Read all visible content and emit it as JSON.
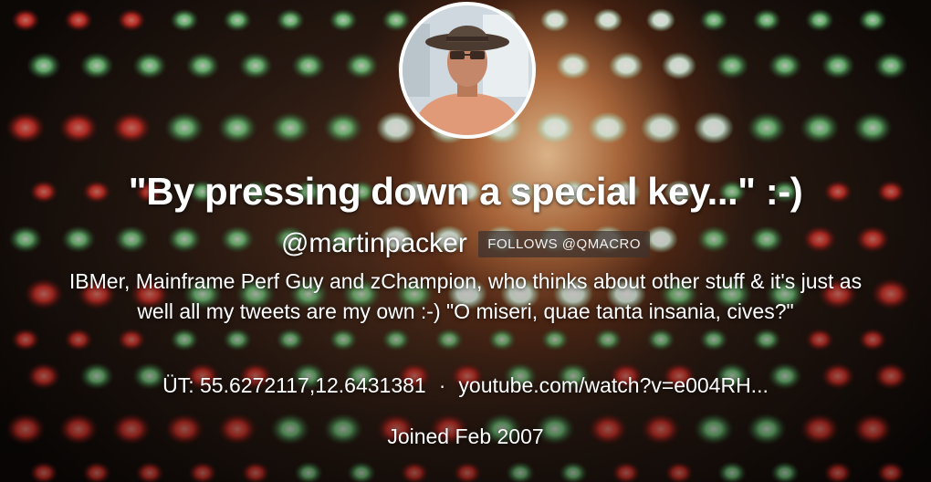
{
  "profile": {
    "display_name": "\"By pressing down a special key...\" :-)",
    "handle": "@martinpacker",
    "follows_badge": "FOLLOWS @QMACRO",
    "bio": "IBMer, Mainframe Perf Guy and zChampion, who thinks about other stuff & it's just as well all my tweets are my own :-) \"O miseri, quae tanta insania, cives?\"",
    "location": "ÜT: 55.6272117,12.6431381",
    "separator": "·",
    "website": "youtube.com/watch?v=e004RH...",
    "joined": "Joined Feb 2007"
  },
  "colors": {
    "led_green": "#7de08a",
    "led_red": "#e8332b",
    "text": "#ffffff",
    "avatar_border": "#ffffff"
  }
}
